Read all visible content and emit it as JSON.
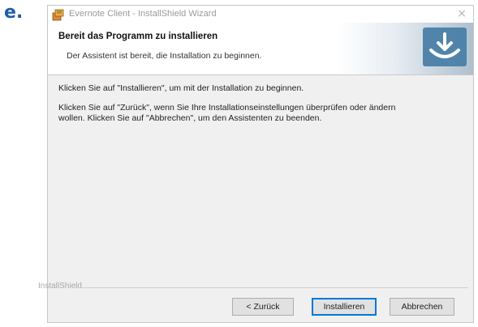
{
  "step_label": "e.",
  "window": {
    "title": "Evernote Client - InstallShield Wizard",
    "close_glyph": "×"
  },
  "banner": {
    "title": "Bereit das Programm zu installieren",
    "subtitle": "Der Assistent ist bereit, die Installation zu beginnen.",
    "logo_icon": "installer-logo-icon"
  },
  "body": {
    "paragraph1": "Klicken Sie auf \"Installieren\", um mit der Installation zu beginnen.",
    "paragraph2_line1": "Klicken Sie auf \"Zurück\", wenn Sie Ihre Installationseinstellungen überprüfen oder ändern",
    "paragraph2_line2": "wollen. Klicken Sie auf \"Abbrechen\", um den Assistenten zu beenden."
  },
  "footer": {
    "brand": "InstallShield"
  },
  "buttons": {
    "back": "< Zurück",
    "install": "Installieren",
    "cancel": "Abbrechen"
  },
  "colors": {
    "accent": "#0078d7",
    "step_label": "#1f5fa8"
  }
}
